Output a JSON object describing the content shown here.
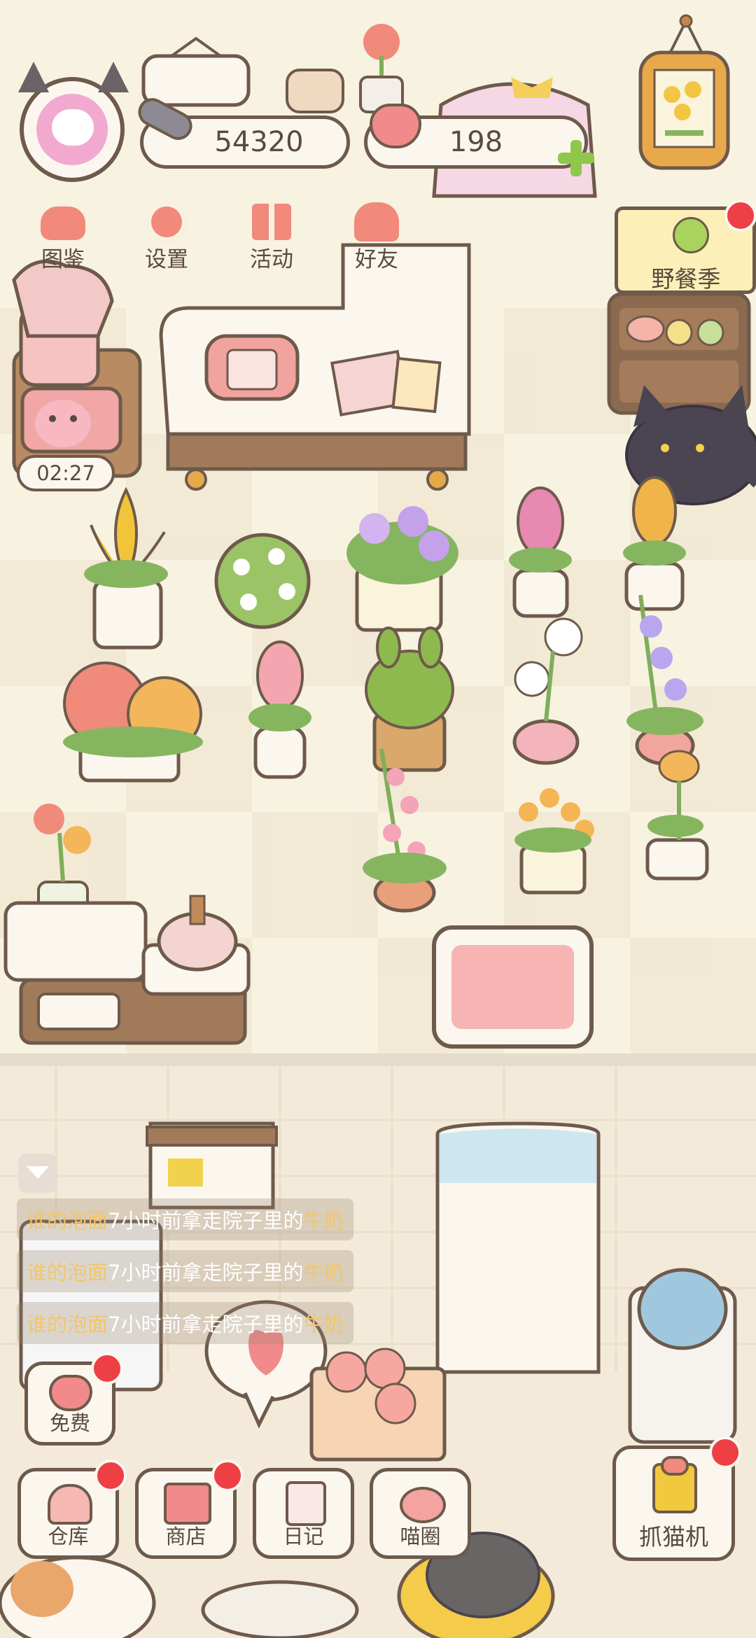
{
  "hud": {
    "fish_count": "54320",
    "heart_count": "198"
  },
  "menu": {
    "items": [
      {
        "label": "图鉴",
        "icon": "catalog-cat-icon"
      },
      {
        "label": "设置",
        "icon": "settings-gear-icon"
      },
      {
        "label": "活动",
        "icon": "gift-icon"
      },
      {
        "label": "好友",
        "icon": "friends-icon"
      }
    ]
  },
  "timer": "02:27",
  "event": {
    "label": "野餐季"
  },
  "feed": {
    "messages": [
      {
        "who": "谁的泡面",
        "action": "7小时前拿走院子里的",
        "item": "牛奶"
      },
      {
        "who": "谁的泡面",
        "action": "7小时前拿走院子里的",
        "item": "牛奶"
      },
      {
        "who": "谁的泡面",
        "action": "7小时前拿走院子里的",
        "item": "牛奶"
      }
    ]
  },
  "bottom": {
    "free": "免费",
    "warehouse": "仓库",
    "shop": "商店",
    "diary": "日记",
    "circle": "喵圈",
    "catch": "抓猫机"
  },
  "colors": {
    "outline": "#6e5a4b",
    "badge": "#ee3f45",
    "accent_green": "#8fc74a",
    "highlight_text": "#f2c66a",
    "floor": "#f6f0e0"
  }
}
